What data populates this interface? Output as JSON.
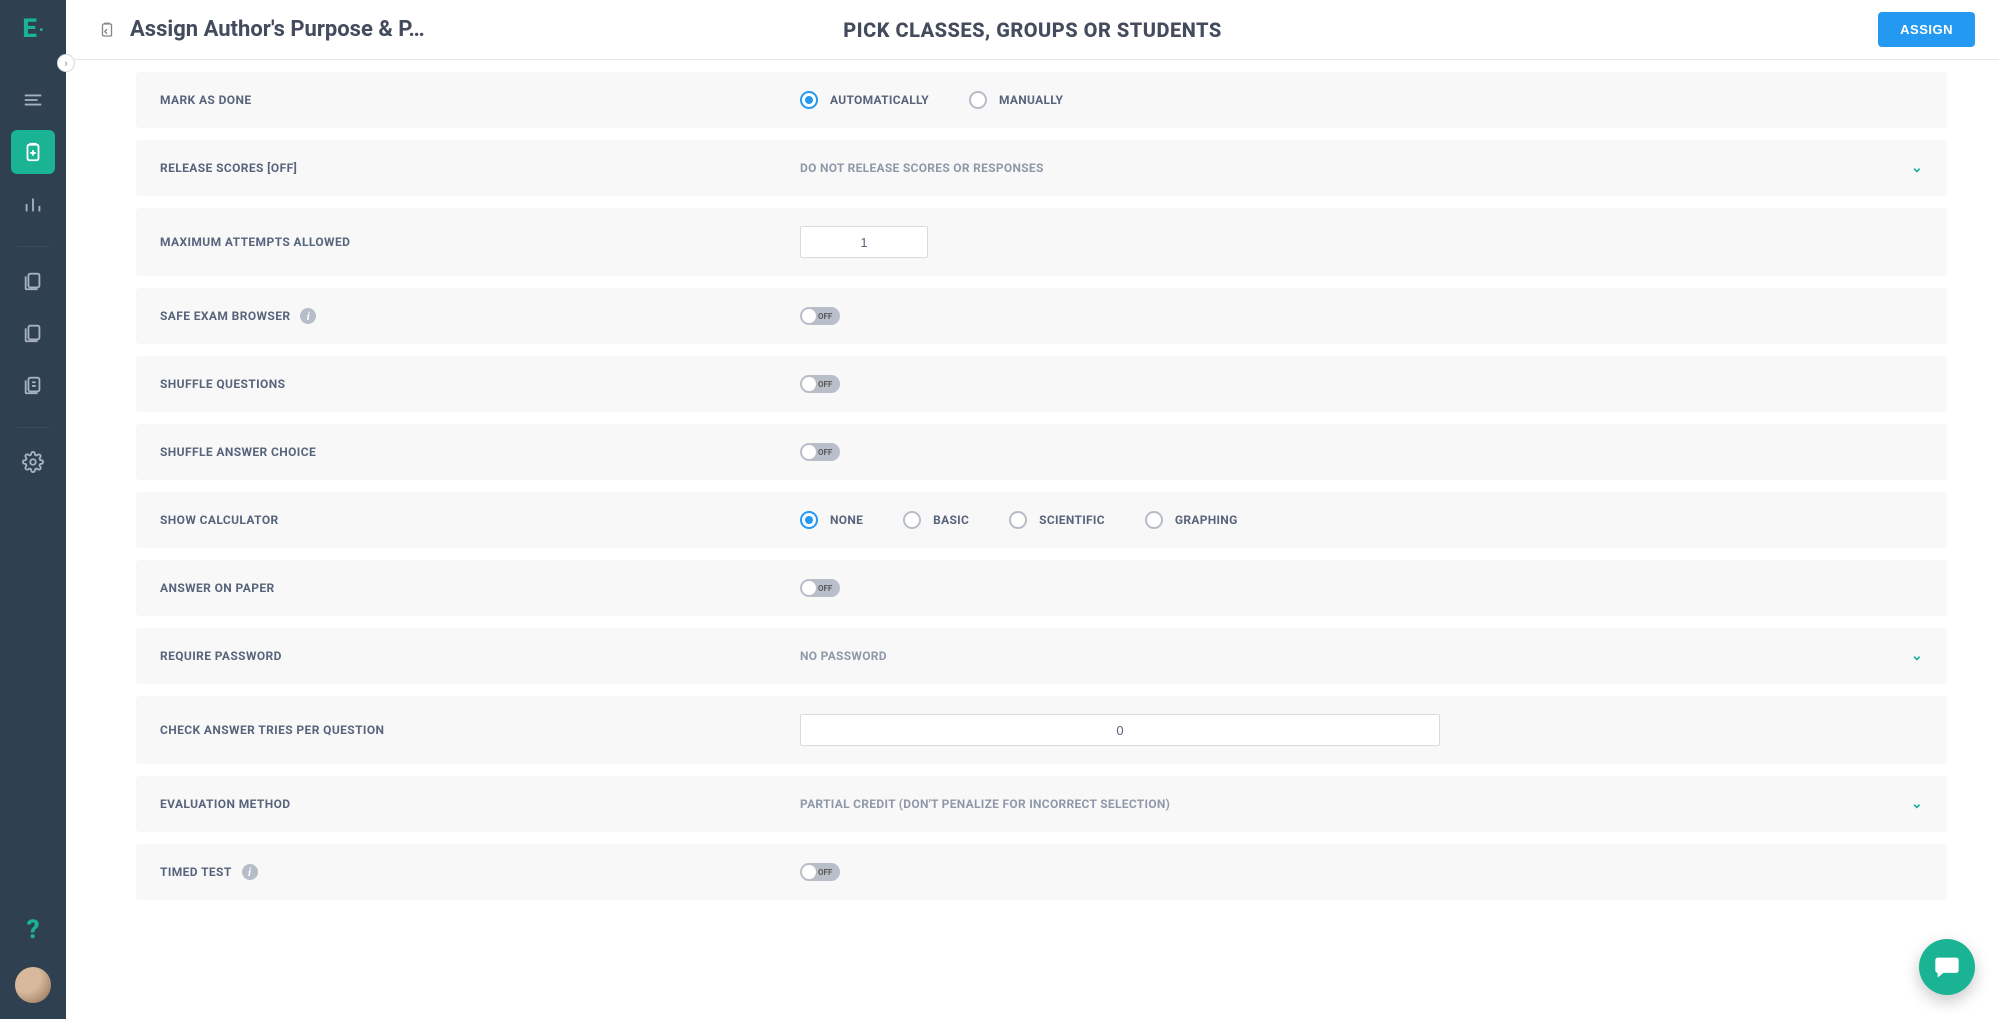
{
  "sidebar": {
    "logo": "E",
    "items": [
      "dashboard",
      "assignments",
      "reports",
      "library1",
      "library2",
      "library3",
      "settings"
    ]
  },
  "header": {
    "title": "Assign Author's Purpose & P…",
    "center": "PICK CLASSES, GROUPS OR STUDENTS",
    "assign_label": "ASSIGN"
  },
  "settings": {
    "mark_as_done": {
      "label": "MARK AS DONE",
      "options": {
        "auto": "AUTOMATICALLY",
        "manual": "MANUALLY"
      },
      "selected": "auto"
    },
    "release_scores": {
      "label": "RELEASE SCORES [OFF]",
      "value": "DO NOT RELEASE SCORES OR RESPONSES"
    },
    "max_attempts": {
      "label": "MAXIMUM ATTEMPTS ALLOWED",
      "value": "1"
    },
    "safe_exam_browser": {
      "label": "SAFE EXAM BROWSER",
      "toggle": "OFF"
    },
    "shuffle_questions": {
      "label": "SHUFFLE QUESTIONS",
      "toggle": "OFF"
    },
    "shuffle_answer_choice": {
      "label": "SHUFFLE ANSWER CHOICE",
      "toggle": "OFF"
    },
    "show_calculator": {
      "label": "SHOW CALCULATOR",
      "options": {
        "none": "NONE",
        "basic": "BASIC",
        "scientific": "SCIENTIFIC",
        "graphing": "GRAPHING"
      },
      "selected": "none"
    },
    "answer_on_paper": {
      "label": "ANSWER ON PAPER",
      "toggle": "OFF"
    },
    "require_password": {
      "label": "REQUIRE PASSWORD",
      "value": "NO PASSWORD"
    },
    "check_answer_tries": {
      "label": "CHECK ANSWER TRIES PER QUESTION",
      "value": "0"
    },
    "evaluation_method": {
      "label": "EVALUATION METHOD",
      "value": "PARTIAL CREDIT (DON'T PENALIZE FOR INCORRECT SELECTION)"
    },
    "timed_test": {
      "label": "TIMED TEST",
      "toggle": "OFF"
    }
  }
}
